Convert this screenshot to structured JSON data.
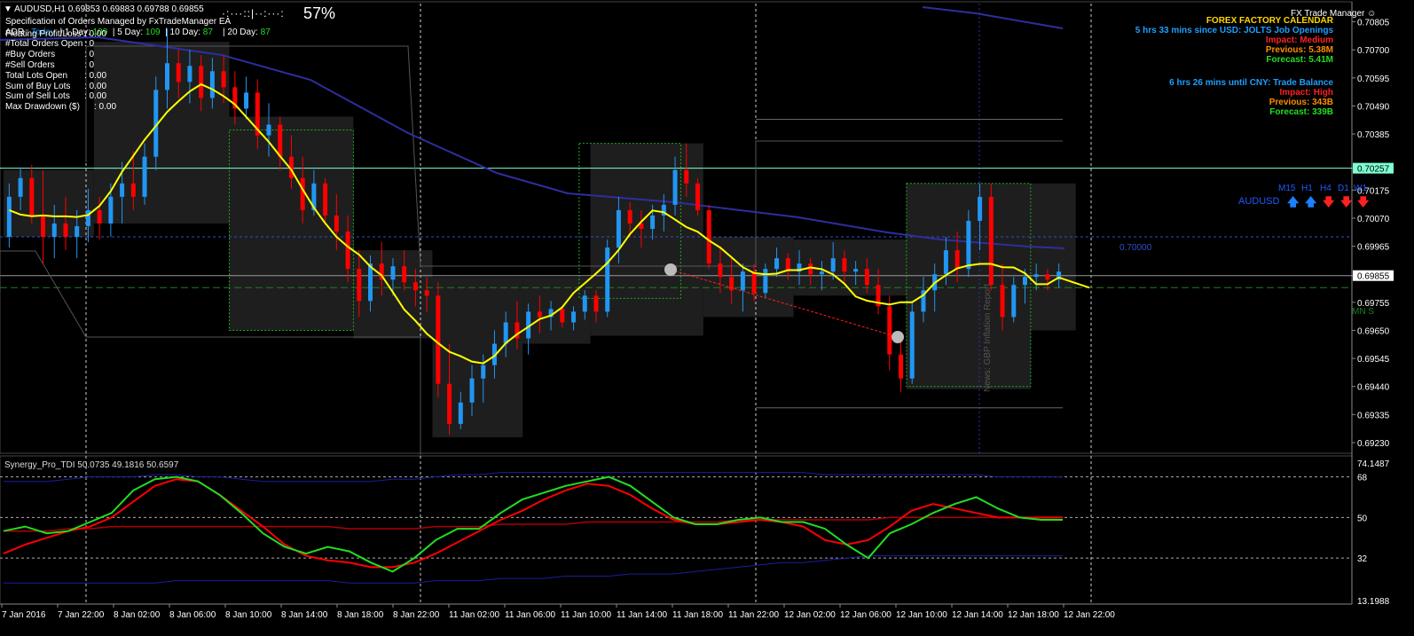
{
  "colors": {
    "background": "#000000",
    "bull": "#2196F3",
    "bear": "#FF0000",
    "ma_fast": "#FFFF00",
    "ma_slow": "#2E2E9E",
    "tdi_green": "#22DD22",
    "tdi_red": "#FF0000",
    "tdi_band": "#1C1CA0",
    "grid": "#FFFFFF",
    "box": "#1E1E1E",
    "cyan_line": "#7FFFD4"
  },
  "header": {
    "symbol_line": "AUDUSD,H1  0.69853 0.69883 0.69788 0.69855",
    "ea_spec": "Specification of Orders Managed by FxTradeManager EA",
    "progress_dots": "·:···::|··:···:",
    "progress_pct": "57%",
    "day_stats": {
      "today_label": "ADR :",
      "today_text": "Today",
      "d1_label": "| 1 Day:",
      "d1_val": "109",
      "d5_label": "| 5 Day:",
      "d5_val": "109",
      "d10_label": "| 10 Day:",
      "d10_val": "87",
      "d20_label": "| 20 Day:",
      "d20_val": "87"
    },
    "stats": [
      {
        "label": "Floating Profit/Loss",
        "value": ": 0.00"
      },
      {
        "label": "#Total Orders Open",
        "value": ": 0"
      },
      {
        "label": "#Buy Orders",
        "value": ": 0"
      },
      {
        "label": "#Sell Orders",
        "value": ": 0"
      },
      {
        "label": "Total Lots Open",
        "value": ": 0.00"
      },
      {
        "label": "Sum of Buy Lots",
        "value": ": 0.00"
      },
      {
        "label": "Sum of Sell Lots",
        "value": ": 0.00"
      },
      {
        "label": "Max Drawdown ($)",
        "value": ": 0.00"
      }
    ]
  },
  "news_panel": {
    "title": "FX Trade Manager",
    "calendar": "FOREX FACTORY CALENDAR",
    "events": [
      {
        "heading": "5 hrs 33 mins since USD: JOLTS Job Openings",
        "impact": "Impact: Medium",
        "previous": "Previous: 5.38M",
        "forecast": "Forecast: 5.41M"
      },
      {
        "heading": "6 hrs 26 mins until CNY: Trade Balance",
        "impact": "Impact: High",
        "previous": "Previous: 343B",
        "forecast": "Forecast: 339B"
      }
    ]
  },
  "tf_panel": {
    "timeframes": [
      "M15",
      "H1",
      "H4",
      "D1",
      "W1"
    ],
    "symbol": "AUDUSD",
    "arrows": [
      "up",
      "up",
      "down",
      "down",
      "down"
    ]
  },
  "labels": {
    "level_70000": "0.70000",
    "mn_label": "MN S",
    "news_vertical": "News: GBP Inflation Report",
    "indicator_title": "Synergy_Pro_TDI 50.0735 49.1816 50.6597"
  },
  "chart_data": {
    "type": "candlestick",
    "price_axis": [
      "0.70805",
      "0.70700",
      "0.70595",
      "0.70490",
      "0.70385",
      "0.70257",
      "0.70175",
      "0.70070",
      "0.69965",
      "0.69855",
      "0.69755",
      "0.69650",
      "0.69545",
      "0.69440",
      "0.69335",
      "0.69230"
    ],
    "price_axis_highlights": {
      "cyan_level": "0.70257",
      "current_price": "0.69855"
    },
    "ylim": [
      0.692,
      0.7086
    ],
    "time_axis": [
      "7 Jan 2016",
      "7 Jan 22:00",
      "8 Jan 02:00",
      "8 Jan 06:00",
      "8 Jan 10:00",
      "8 Jan 14:00",
      "8 Jan 18:00",
      "8 Jan 22:00",
      "11 Jan 02:00",
      "11 Jan 06:00",
      "11 Jan 10:00",
      "11 Jan 14:00",
      "11 Jan 18:00",
      "11 Jan 22:00",
      "12 Jan 02:00",
      "12 Jan 06:00",
      "12 Jan 10:00",
      "12 Jan 14:00",
      "12 Jan 18:00",
      "12 Jan 22:00"
    ],
    "candles": [
      [
        0.7,
        0.702,
        0.6996,
        0.7015
      ],
      [
        0.7015,
        0.7026,
        0.701,
        0.7022
      ],
      [
        0.7022,
        0.7027,
        0.7005,
        0.7008
      ],
      [
        0.7008,
        0.7025,
        0.699,
        0.7
      ],
      [
        0.7,
        0.7012,
        0.6992,
        0.7005
      ],
      [
        0.7005,
        0.7015,
        0.6995,
        0.7
      ],
      [
        0.7,
        0.701,
        0.6992,
        0.7004
      ],
      [
        0.7004,
        0.7018,
        0.6998,
        0.701
      ],
      [
        0.701,
        0.7015,
        0.6999,
        0.7005
      ],
      [
        0.7005,
        0.702,
        0.7,
        0.7015
      ],
      [
        0.7015,
        0.7028,
        0.7005,
        0.702
      ],
      [
        0.702,
        0.7032,
        0.701,
        0.7015
      ],
      [
        0.7015,
        0.7035,
        0.7012,
        0.703
      ],
      [
        0.703,
        0.706,
        0.7025,
        0.7055
      ],
      [
        0.7055,
        0.7078,
        0.7048,
        0.7065
      ],
      [
        0.7065,
        0.707,
        0.7052,
        0.7058
      ],
      [
        0.7058,
        0.707,
        0.705,
        0.7064
      ],
      [
        0.7064,
        0.7068,
        0.7047,
        0.7052
      ],
      [
        0.7052,
        0.7067,
        0.7048,
        0.7062
      ],
      [
        0.7062,
        0.7068,
        0.705,
        0.7056
      ],
      [
        0.7056,
        0.7062,
        0.7042,
        0.7048
      ],
      [
        0.7048,
        0.706,
        0.7044,
        0.7054
      ],
      [
        0.7054,
        0.7059,
        0.7033,
        0.7038
      ],
      [
        0.7038,
        0.705,
        0.703,
        0.7042
      ],
      [
        0.7042,
        0.7045,
        0.7025,
        0.703
      ],
      [
        0.703,
        0.7038,
        0.7018,
        0.7022
      ],
      [
        0.7022,
        0.703,
        0.7005,
        0.701
      ],
      [
        0.701,
        0.7025,
        0.7008,
        0.702
      ],
      [
        0.702,
        0.7022,
        0.7005,
        0.7008
      ],
      [
        0.7008,
        0.7016,
        0.6995,
        0.7002
      ],
      [
        0.7002,
        0.7008,
        0.6983,
        0.6988
      ],
      [
        0.6988,
        0.6995,
        0.697,
        0.6976
      ],
      [
        0.6976,
        0.6993,
        0.6972,
        0.699
      ],
      [
        0.699,
        0.6998,
        0.6978,
        0.6984
      ],
      [
        0.6984,
        0.6992,
        0.6978,
        0.6989
      ],
      [
        0.6989,
        0.6995,
        0.698,
        0.6983
      ],
      [
        0.6983,
        0.6988,
        0.6974,
        0.698
      ],
      [
        0.698,
        0.6985,
        0.6972,
        0.6978
      ],
      [
        0.6978,
        0.6983,
        0.694,
        0.6945
      ],
      [
        0.6945,
        0.696,
        0.6926,
        0.693
      ],
      [
        0.693,
        0.6942,
        0.6928,
        0.6938
      ],
      [
        0.6938,
        0.6952,
        0.6933,
        0.6947
      ],
      [
        0.6947,
        0.6956,
        0.6938,
        0.6952
      ],
      [
        0.6952,
        0.6965,
        0.6947,
        0.696
      ],
      [
        0.696,
        0.6972,
        0.6955,
        0.6968
      ],
      [
        0.6968,
        0.6976,
        0.6958,
        0.6962
      ],
      [
        0.6962,
        0.6975,
        0.6956,
        0.6972
      ],
      [
        0.6972,
        0.6978,
        0.6964,
        0.697
      ],
      [
        0.697,
        0.6976,
        0.6965,
        0.6973
      ],
      [
        0.6973,
        0.6974,
        0.6966,
        0.6968
      ],
      [
        0.6968,
        0.6974,
        0.6965,
        0.6972
      ],
      [
        0.6972,
        0.698,
        0.6969,
        0.6978
      ],
      [
        0.6978,
        0.698,
        0.6968,
        0.6972
      ],
      [
        0.6972,
        0.6999,
        0.697,
        0.6996
      ],
      [
        0.6996,
        0.7015,
        0.699,
        0.701
      ],
      [
        0.701,
        0.7013,
        0.7,
        0.7005
      ],
      [
        0.7005,
        0.701,
        0.6996,
        0.7003
      ],
      [
        0.7003,
        0.7012,
        0.6999,
        0.7008
      ],
      [
        0.7008,
        0.7016,
        0.7002,
        0.7012
      ],
      [
        0.7012,
        0.703,
        0.7008,
        0.7025
      ],
      [
        0.7025,
        0.7035,
        0.7015,
        0.702
      ],
      [
        0.702,
        0.7022,
        0.7008,
        0.701
      ],
      [
        0.701,
        0.7012,
        0.6988,
        0.699
      ],
      [
        0.699,
        0.6996,
        0.6979,
        0.6985
      ],
      [
        0.6985,
        0.6992,
        0.6975,
        0.698
      ],
      [
        0.698,
        0.699,
        0.6972,
        0.6987
      ],
      [
        0.6987,
        0.699,
        0.6976,
        0.6979
      ],
      [
        0.6979,
        0.699,
        0.6977,
        0.6988
      ],
      [
        0.6988,
        0.6996,
        0.6985,
        0.6992
      ],
      [
        0.6992,
        0.6994,
        0.6984,
        0.6987
      ],
      [
        0.6987,
        0.6995,
        0.6982,
        0.699
      ],
      [
        0.699,
        0.6992,
        0.6982,
        0.6986
      ],
      [
        0.6986,
        0.6991,
        0.698,
        0.6987
      ],
      [
        0.6987,
        0.6998,
        0.6984,
        0.6992
      ],
      [
        0.6992,
        0.6995,
        0.6983,
        0.6987
      ],
      [
        0.6987,
        0.6991,
        0.6982,
        0.6988
      ],
      [
        0.6988,
        0.6992,
        0.6979,
        0.6982
      ],
      [
        0.6982,
        0.6988,
        0.6971,
        0.6974
      ],
      [
        0.6974,
        0.6978,
        0.695,
        0.6956
      ],
      [
        0.6956,
        0.6962,
        0.6942,
        0.6947
      ],
      [
        0.6947,
        0.6976,
        0.6945,
        0.6972
      ],
      [
        0.6972,
        0.6985,
        0.6968,
        0.698
      ],
      [
        0.698,
        0.699,
        0.6972,
        0.6986
      ],
      [
        0.6986,
        0.7,
        0.6982,
        0.6995
      ],
      [
        0.6995,
        0.7002,
        0.6983,
        0.6988
      ],
      [
        0.6988,
        0.701,
        0.6985,
        0.7006
      ],
      [
        0.7006,
        0.702,
        0.6995,
        0.7015
      ],
      [
        0.7015,
        0.702,
        0.698,
        0.6982
      ],
      [
        0.6982,
        0.699,
        0.6965,
        0.697
      ],
      [
        0.697,
        0.6985,
        0.6968,
        0.6982
      ],
      [
        0.6982,
        0.6988,
        0.6975,
        0.6985
      ],
      [
        0.6985,
        0.699,
        0.698,
        0.6986
      ],
      [
        0.6986,
        0.6988,
        0.698,
        0.6984
      ],
      [
        0.6984,
        0.699,
        0.6981,
        0.6987
      ]
    ],
    "series": [
      {
        "name": "MA fast"
      },
      {
        "name": "MA slow"
      }
    ],
    "indicator": {
      "name": "Synergy_Pro_TDI",
      "values": [
        "50.0735",
        "49.1816",
        "50.6597"
      ],
      "axis": [
        "74.1487",
        "68",
        "50",
        "32",
        "13.1988"
      ],
      "levels": [
        68,
        50,
        32
      ],
      "ylim": [
        13.1988,
        74.1487
      ],
      "green": [
        44,
        46,
        43,
        44,
        48,
        52,
        62,
        67,
        68,
        66,
        60,
        52,
        43,
        37,
        34,
        37,
        35,
        30,
        26,
        32,
        40,
        45,
        45,
        52,
        58,
        61,
        64,
        66,
        68,
        64,
        57,
        50,
        47,
        47,
        49,
        50,
        48,
        48,
        45,
        38,
        32,
        43,
        47,
        52,
        56,
        59,
        54,
        50,
        49,
        49
      ],
      "red": [
        34,
        38,
        41,
        44,
        46,
        50,
        57,
        64,
        67,
        66,
        60,
        53,
        46,
        38,
        33,
        31,
        30,
        28,
        28,
        30,
        34,
        39,
        44,
        49,
        53,
        58,
        62,
        65,
        64,
        60,
        54,
        49,
        47,
        47,
        48,
        49,
        48,
        46,
        40,
        38,
        40,
        46,
        53,
        56,
        54,
        52,
        50,
        50,
        50,
        50
      ],
      "upper": [
        66,
        66,
        66,
        67,
        68,
        68,
        68,
        69,
        69,
        68,
        68,
        67,
        66,
        66,
        66,
        66,
        66,
        66,
        67,
        67,
        68,
        69,
        69,
        70,
        70,
        70,
        70,
        70,
        70,
        70,
        70,
        70,
        70,
        70,
        70,
        70,
        70,
        70,
        69,
        69,
        69,
        69,
        69,
        69,
        69,
        69,
        68,
        68,
        68,
        68
      ],
      "lower": [
        21,
        21,
        21,
        21,
        21,
        21,
        21,
        21,
        22,
        22,
        22,
        22,
        22,
        22,
        22,
        22,
        21,
        21,
        21,
        21,
        22,
        22,
        22,
        23,
        23,
        23,
        24,
        24,
        24,
        25,
        25,
        25,
        26,
        27,
        28,
        29,
        30,
        30,
        31,
        32,
        33,
        33,
        33,
        33,
        33,
        33,
        33,
        33,
        33,
        33
      ],
      "mid": [
        44,
        44,
        44,
        45,
        45,
        46,
        46,
        46,
        46,
        46,
        46,
        46,
        46,
        46,
        46,
        46,
        45,
        45,
        45,
        45,
        46,
        46,
        46,
        47,
        47,
        47,
        47,
        48,
        48,
        48,
        48,
        48,
        48,
        48,
        49,
        49,
        49,
        49,
        49,
        49,
        49,
        50,
        50,
        50,
        50,
        50,
        50,
        50,
        50,
        50
      ]
    }
  }
}
